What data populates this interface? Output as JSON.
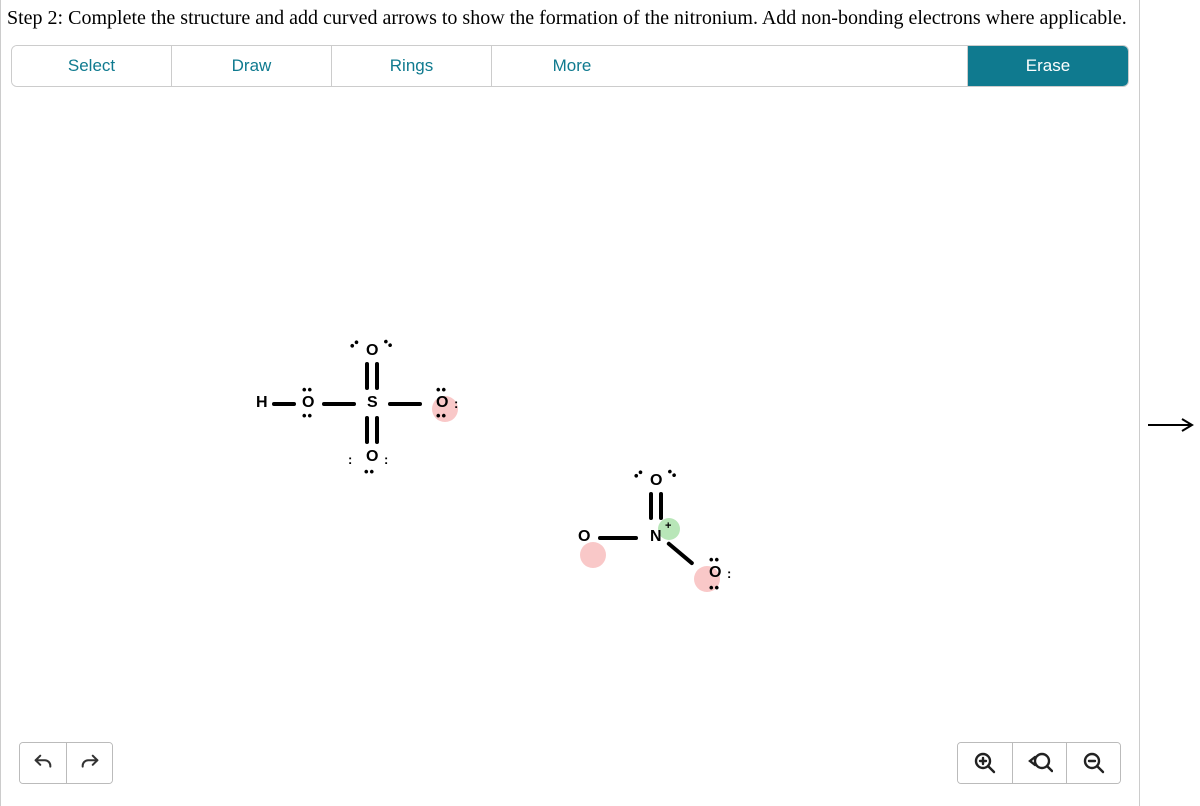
{
  "instruction": "Step 2: Complete the structure and add curved arrows to show the formation of the nitronium. Add non-bonding electrons where applicable.",
  "toolbar": {
    "select": "Select",
    "draw": "Draw",
    "rings": "Rings",
    "more": "More",
    "erase": "Erase"
  },
  "structure1": {
    "atoms": {
      "H": "H",
      "O1": "O",
      "S": "S",
      "O_top": "O",
      "O_bot": "O",
      "O_right": "O"
    },
    "charges": {
      "O_right": "−"
    }
  },
  "structure2": {
    "atoms": {
      "O_left": "O",
      "N": "N",
      "O_top": "O",
      "O_right": "O"
    },
    "charges": {
      "N": "+",
      "O_left": "−",
      "O_right": "−"
    }
  },
  "icons": {
    "undo": "undo-icon",
    "redo": "redo-icon",
    "zoom_in": "zoom-in-icon",
    "reset_zoom": "reset-zoom-icon",
    "zoom_out": "zoom-out-icon"
  }
}
